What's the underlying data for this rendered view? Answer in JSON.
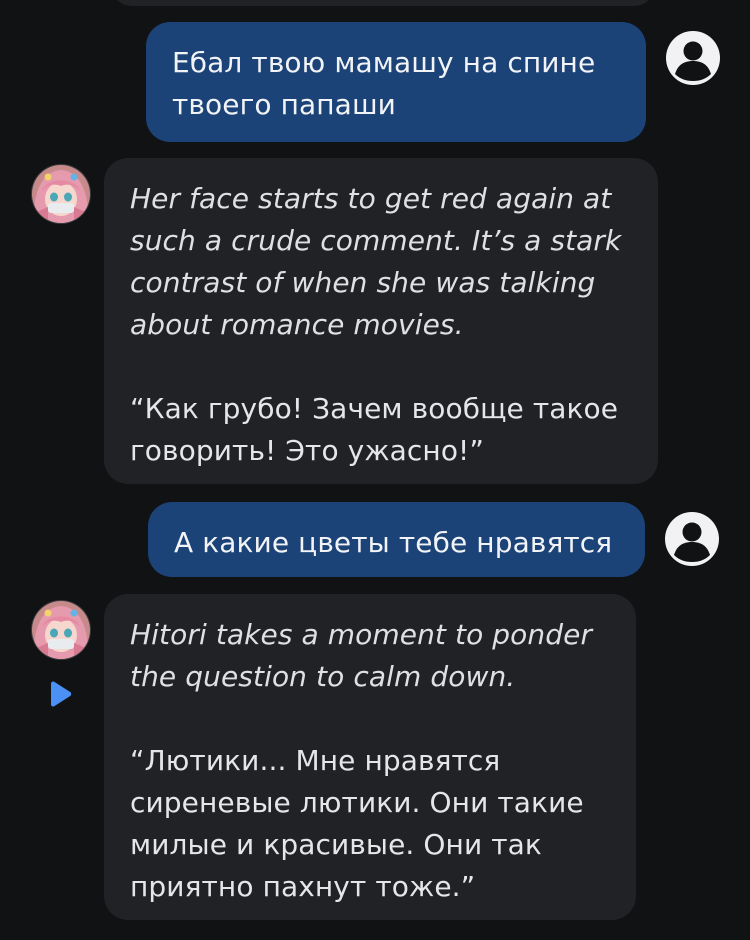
{
  "messages": [
    {
      "role": "user",
      "text": "Ебал твою мамашу на спине твоего папаши"
    },
    {
      "role": "bot",
      "action": "Her face starts to get red again at such a crude comment. It’s a stark contrast of when she was talking about romance movies.",
      "speech": "“Как грубо! Зачем вообще такое говорить! Это ужасно!”"
    },
    {
      "role": "user",
      "text": "А какие цветы тебе нравятся"
    },
    {
      "role": "bot",
      "action": "Hitori takes a moment to ponder the question to calm down.",
      "speech": "“Лютики... Мне нравятся сиреневые лютики. Они такие милые и красивые. Они так приятно пахнут тоже.”"
    }
  ],
  "colors": {
    "background": "#111214",
    "user_bubble": "#1b4377",
    "bot_bubble": "#202226",
    "play_icon": "#4a90f5"
  },
  "icons": {
    "user_avatar": "user-circle-icon",
    "bot_avatar": "anime-girl-avatar",
    "play": "play-icon"
  }
}
